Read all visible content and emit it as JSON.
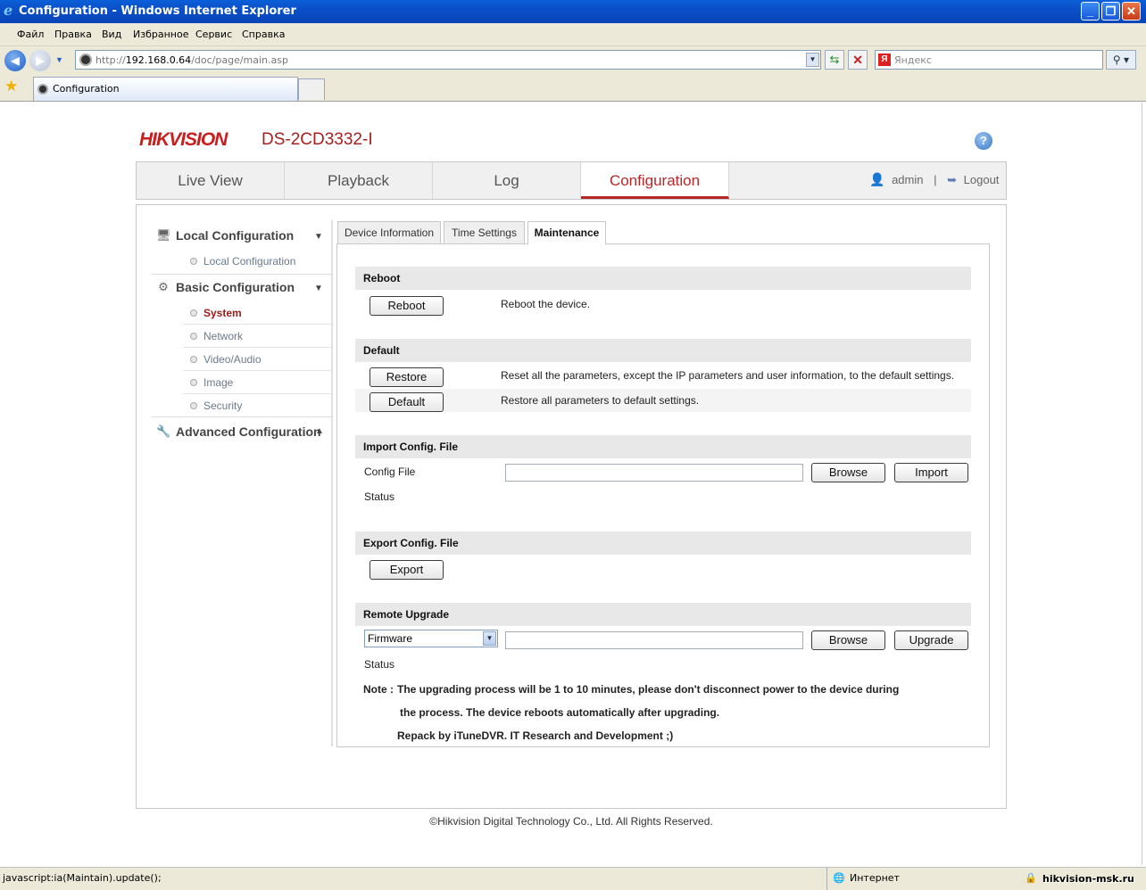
{
  "window": {
    "title": "Configuration - Windows Internet Explorer"
  },
  "menubar": [
    "Файл",
    "Правка",
    "Вид",
    "Избранное",
    "Сервис",
    "Справка"
  ],
  "address": {
    "prefix": "http://",
    "host": "192.168.0.64",
    "path": "/doc/page/main.asp"
  },
  "search": {
    "placeholder": "Яндекс"
  },
  "tab": {
    "label": "Configuration"
  },
  "header": {
    "brand": "HIKVISION",
    "model": "DS-2CD3332-I",
    "help": "?"
  },
  "nav": {
    "tabs": [
      "Live View",
      "Playback",
      "Log",
      "Configuration"
    ],
    "active": "Configuration",
    "user": "admin",
    "separator": "|",
    "logout": "Logout"
  },
  "sidebar": {
    "local_title": "Local Configuration",
    "local_items": [
      "Local Configuration"
    ],
    "basic_title": "Basic Configuration",
    "basic_items": [
      "System",
      "Network",
      "Video/Audio",
      "Image",
      "Security"
    ],
    "advanced_title": "Advanced Configuration"
  },
  "subtabs": [
    "Device Information",
    "Time Settings",
    "Maintenance"
  ],
  "maintenance": {
    "reboot": {
      "title": "Reboot",
      "button": "Reboot",
      "desc": "Reboot the device."
    },
    "default": {
      "title": "Default",
      "restore_button": "Restore",
      "restore_desc": "Reset all the parameters, except the IP parameters and user information, to the default settings.",
      "default_button": "Default",
      "default_desc": "Restore all parameters to default settings."
    },
    "import": {
      "title": "Import Config. File",
      "file_label": "Config File",
      "browse": "Browse",
      "import": "Import",
      "status_label": "Status"
    },
    "export": {
      "title": "Export Config. File",
      "button": "Export"
    },
    "upgrade": {
      "title": "Remote Upgrade",
      "select_value": "Firmware",
      "browse": "Browse",
      "upgrade": "Upgrade",
      "status_label": "Status",
      "note_label": "Note :",
      "note_line1": "The upgrading process will be 1 to 10 minutes, please don't disconnect power to the device during",
      "note_line2": "the process. The device reboots automatically after upgrading.",
      "note_line3": "Repack by iTuneDVR. IT Research and Development ;)"
    }
  },
  "footer": "©Hikvision Digital Technology Co., Ltd. All Rights Reserved.",
  "statusbar": {
    "left": "javascript:ia(Maintain).update();",
    "zone": "Интернет",
    "watermark": "hikvision-msk.ru"
  },
  "colors": {
    "accent": "#b7272a",
    "titlebar": "#0a5fd8"
  }
}
